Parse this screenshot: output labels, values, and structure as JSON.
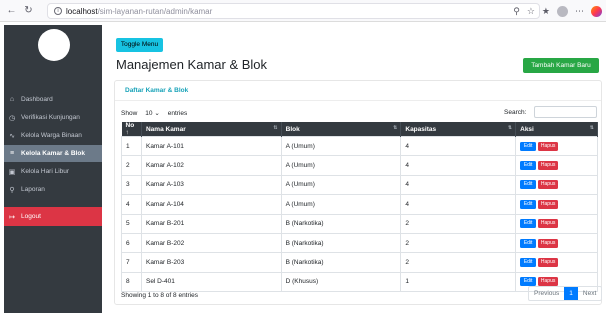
{
  "browser": {
    "url_host": "localhost",
    "url_path": "/sim-layanan-rutan/admin/kamar"
  },
  "sidebar": {
    "items": [
      {
        "label": "Dashboard",
        "icon": "home-icon"
      },
      {
        "label": "Verifikasi Kunjungan",
        "icon": "clock-icon"
      },
      {
        "label": "Kelola Warga Binaan",
        "icon": "users-icon"
      },
      {
        "label": "Kelola Kamar & Blok",
        "icon": "list-icon"
      },
      {
        "label": "Kelola Hari Libur",
        "icon": "calendar-icon"
      },
      {
        "label": "Laporan",
        "icon": "search-icon"
      }
    ],
    "logout_label": "Logout"
  },
  "main": {
    "toggle_label": "Toggle Menu",
    "title": "Manajemen Kamar & Blok",
    "add_button_label": "Tambah Kamar Baru",
    "card_title": "Daftar Kamar & Blok",
    "show_label": "Show",
    "show_value": "10",
    "entries_label": "entries",
    "search_label": "Search:",
    "columns": [
      "No",
      "Nama Kamar",
      "Blok",
      "Kapasitas",
      "Aksi"
    ],
    "rows": [
      {
        "no": "1",
        "nama": "Kamar A-101",
        "blok": "A (Umum)",
        "kapasitas": "4"
      },
      {
        "no": "2",
        "nama": "Kamar A-102",
        "blok": "A (Umum)",
        "kapasitas": "4"
      },
      {
        "no": "3",
        "nama": "Kamar A-103",
        "blok": "A (Umum)",
        "kapasitas": "4"
      },
      {
        "no": "4",
        "nama": "Kamar A-104",
        "blok": "A (Umum)",
        "kapasitas": "4"
      },
      {
        "no": "5",
        "nama": "Kamar B-201",
        "blok": "B (Narkotika)",
        "kapasitas": "2"
      },
      {
        "no": "6",
        "nama": "Kamar B-202",
        "blok": "B (Narkotika)",
        "kapasitas": "2"
      },
      {
        "no": "7",
        "nama": "Kamar B-203",
        "blok": "B (Narkotika)",
        "kapasitas": "2"
      },
      {
        "no": "8",
        "nama": "Sel D-401",
        "blok": "D (Khusus)",
        "kapasitas": "1"
      }
    ],
    "edit_label": "Edit",
    "delete_label": "Hapus",
    "info_text": "Showing 1 to 8 of 8 entries",
    "pager": {
      "previous": "Previous",
      "current": "1",
      "next": "Next"
    }
  },
  "colors": {
    "sidebar_bg": "#343a40",
    "active_item_bg": "#6c7a89",
    "logout_bg": "#dc3545",
    "toggle_bg": "#17c3e2",
    "add_bg": "#28a745",
    "edit_bg": "#007bff",
    "delete_bg": "#dc3545"
  }
}
